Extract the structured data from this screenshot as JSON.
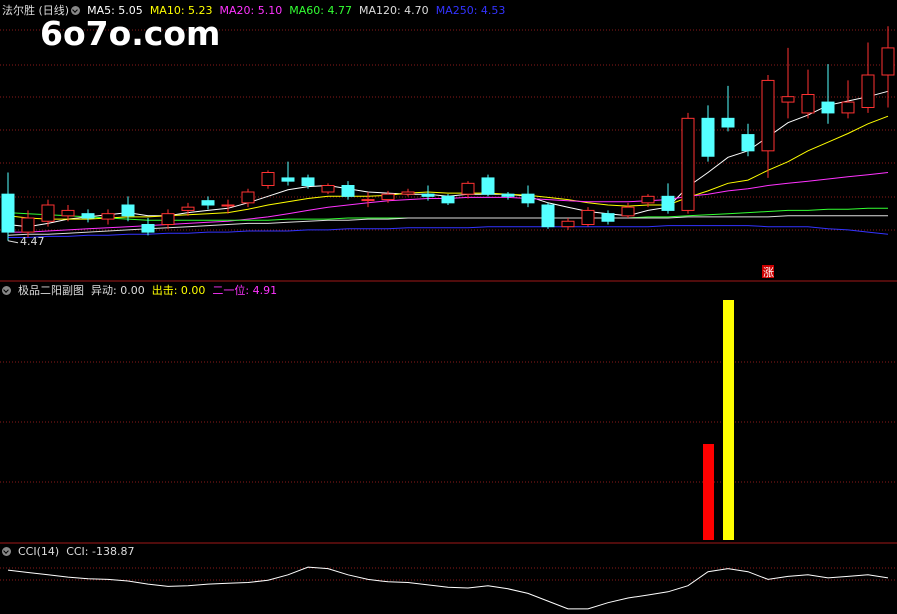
{
  "watermark": "6o7o.com",
  "main_panel": {
    "title": "法尔胜 (日线)",
    "legend": [
      {
        "label": "MA5: 5.05",
        "color": "#ffffff"
      },
      {
        "label": "MA10: 5.23",
        "color": "#ffff00"
      },
      {
        "label": "MA20: 5.10",
        "color": "#ff33ff"
      },
      {
        "label": "MA60: 4.77",
        "color": "#33ff33"
      },
      {
        "label": "MA120: 4.70",
        "color": "#dddddd"
      },
      {
        "label": "MA250: 4.53",
        "color": "#3333ff"
      }
    ],
    "low_mark": "4.47",
    "zhang_mark": "涨"
  },
  "sub_panel": {
    "title": "极品二阳副图",
    "legend": [
      {
        "label": "异动: 0.00",
        "color": "#dddddd"
      },
      {
        "label": "出击: 0.00",
        "color": "#ffff00"
      },
      {
        "label": "二一位: 4.91",
        "color": "#ff33ff"
      }
    ]
  },
  "cci_panel": {
    "title": "CCI(14)",
    "legend": [
      {
        "label": "CCI: -138.87",
        "color": "#dddddd"
      }
    ]
  },
  "chart_data": [
    {
      "type": "candlestick",
      "candles": [
        [
          4.9,
          4.55,
          5.1,
          4.47
        ],
        [
          4.55,
          4.68,
          4.75,
          4.5
        ],
        [
          4.65,
          4.8,
          4.85,
          4.6
        ],
        [
          4.7,
          4.75,
          4.8,
          4.65
        ],
        [
          4.72,
          4.68,
          4.76,
          4.64
        ],
        [
          4.67,
          4.72,
          4.76,
          4.62
        ],
        [
          4.8,
          4.7,
          4.88,
          4.65
        ],
        [
          4.62,
          4.55,
          4.68,
          4.52
        ],
        [
          4.62,
          4.72,
          4.76,
          4.58
        ],
        [
          4.75,
          4.78,
          4.82,
          4.7
        ],
        [
          4.84,
          4.8,
          4.88,
          4.76
        ],
        [
          4.8,
          4.8,
          4.85,
          4.72
        ],
        [
          4.82,
          4.92,
          4.95,
          4.78
        ],
        [
          4.98,
          5.1,
          5.12,
          4.95
        ],
        [
          5.05,
          5.02,
          5.2,
          4.98
        ],
        [
          5.05,
          4.98,
          5.08,
          4.95
        ],
        [
          4.92,
          4.98,
          5.0,
          4.9
        ],
        [
          4.98,
          4.88,
          5.02,
          4.85
        ],
        [
          4.85,
          4.85,
          4.92,
          4.78
        ],
        [
          4.85,
          4.9,
          4.93,
          4.82
        ],
        [
          4.9,
          4.92,
          4.95,
          4.88
        ],
        [
          4.9,
          4.88,
          4.98,
          4.84
        ],
        [
          4.88,
          4.82,
          4.9,
          4.8
        ],
        [
          4.9,
          5.0,
          5.02,
          4.86
        ],
        [
          5.05,
          4.9,
          5.08,
          4.88
        ],
        [
          4.9,
          4.88,
          4.92,
          4.85
        ],
        [
          4.9,
          4.82,
          4.98,
          4.78
        ],
        [
          4.8,
          4.6,
          4.82,
          4.58
        ],
        [
          4.6,
          4.65,
          4.68,
          4.57
        ],
        [
          4.62,
          4.75,
          4.78,
          4.6
        ],
        [
          4.72,
          4.65,
          4.75,
          4.62
        ],
        [
          4.7,
          4.78,
          4.82,
          4.68
        ],
        [
          4.82,
          4.88,
          4.9,
          4.78
        ],
        [
          4.88,
          4.75,
          5.0,
          4.72
        ],
        [
          4.75,
          5.6,
          5.65,
          4.72
        ],
        [
          5.6,
          5.25,
          5.72,
          5.2
        ],
        [
          5.6,
          5.52,
          5.9,
          5.48
        ],
        [
          5.45,
          5.3,
          5.55,
          5.25
        ],
        [
          5.3,
          5.95,
          6.0,
          5.05
        ],
        [
          5.75,
          5.8,
          6.25,
          5.6
        ],
        [
          5.65,
          5.82,
          6.05,
          5.6
        ],
        [
          5.75,
          5.65,
          6.1,
          5.55
        ],
        [
          5.65,
          5.75,
          5.95,
          5.6
        ],
        [
          5.7,
          6.0,
          6.3,
          5.65
        ],
        [
          6.0,
          6.25,
          6.45,
          5.7
        ]
      ],
      "ma": {
        "MA5": [
          4.62,
          4.6,
          4.63,
          4.67,
          4.69,
          4.71,
          4.73,
          4.7,
          4.7,
          4.73,
          4.75,
          4.77,
          4.82,
          4.88,
          4.94,
          4.97,
          4.98,
          4.95,
          4.92,
          4.91,
          4.9,
          4.9,
          4.88,
          4.9,
          4.9,
          4.9,
          4.88,
          4.82,
          4.78,
          4.74,
          4.72,
          4.7,
          4.75,
          4.78,
          4.97,
          5.1,
          5.24,
          5.3,
          5.43,
          5.56,
          5.63,
          5.72,
          5.76,
          5.8,
          5.85
        ],
        "MA10": [
          4.7,
          4.68,
          4.67,
          4.67,
          4.67,
          4.68,
          4.69,
          4.69,
          4.7,
          4.71,
          4.72,
          4.73,
          4.76,
          4.8,
          4.83,
          4.86,
          4.88,
          4.88,
          4.88,
          4.89,
          4.91,
          4.92,
          4.91,
          4.91,
          4.91,
          4.9,
          4.89,
          4.87,
          4.85,
          4.82,
          4.8,
          4.79,
          4.8,
          4.8,
          4.87,
          4.93,
          5.0,
          5.03,
          5.12,
          5.2,
          5.3,
          5.38,
          5.46,
          5.55,
          5.62
        ],
        "MA20": [
          4.55,
          4.55,
          4.56,
          4.57,
          4.58,
          4.59,
          4.6,
          4.61,
          4.62,
          4.63,
          4.64,
          4.65,
          4.67,
          4.69,
          4.72,
          4.75,
          4.78,
          4.8,
          4.82,
          4.84,
          4.85,
          4.86,
          4.86,
          4.87,
          4.87,
          4.87,
          4.86,
          4.85,
          4.84,
          4.83,
          4.83,
          4.83,
          4.84,
          4.85,
          4.88,
          4.9,
          4.93,
          4.95,
          4.98,
          5.0,
          5.02,
          5.04,
          5.06,
          5.08,
          5.1
        ],
        "MA60": [
          4.73,
          4.72,
          4.71,
          4.7,
          4.69,
          4.68,
          4.67,
          4.66,
          4.66,
          4.66,
          4.66,
          4.66,
          4.66,
          4.66,
          4.67,
          4.67,
          4.67,
          4.68,
          4.68,
          4.68,
          4.68,
          4.68,
          4.68,
          4.68,
          4.68,
          4.68,
          4.68,
          4.68,
          4.68,
          4.68,
          4.68,
          4.68,
          4.69,
          4.69,
          4.7,
          4.71,
          4.72,
          4.73,
          4.74,
          4.75,
          4.75,
          4.76,
          4.76,
          4.77,
          4.77
        ],
        "MA120": [
          4.52,
          4.53,
          4.53,
          4.54,
          4.55,
          4.56,
          4.57,
          4.58,
          4.59,
          4.6,
          4.61,
          4.62,
          4.63,
          4.63,
          4.64,
          4.65,
          4.66,
          4.66,
          4.67,
          4.67,
          4.68,
          4.68,
          4.68,
          4.68,
          4.68,
          4.68,
          4.68,
          4.68,
          4.68,
          4.68,
          4.68,
          4.68,
          4.68,
          4.68,
          4.69,
          4.69,
          4.69,
          4.69,
          4.69,
          4.7,
          4.7,
          4.7,
          4.7,
          4.7,
          4.7
        ],
        "MA250": [
          4.5,
          4.5,
          4.51,
          4.51,
          4.52,
          4.52,
          4.53,
          4.53,
          4.54,
          4.54,
          4.55,
          4.55,
          4.56,
          4.56,
          4.56,
          4.57,
          4.57,
          4.58,
          4.58,
          4.58,
          4.59,
          4.59,
          4.59,
          4.59,
          4.6,
          4.6,
          4.6,
          4.6,
          4.6,
          4.6,
          4.6,
          4.6,
          4.6,
          4.61,
          4.61,
          4.61,
          4.61,
          4.61,
          4.6,
          4.6,
          4.6,
          4.58,
          4.57,
          4.55,
          4.53
        ]
      },
      "ylim": [
        4.2,
        6.6
      ]
    },
    {
      "type": "bar",
      "bars": [
        {
          "index": 35,
          "value": 0.4,
          "color": "#ff0000"
        },
        {
          "index": 36,
          "value": 1.0,
          "color": "#ffff00"
        }
      ],
      "ylim": [
        0,
        1.0
      ]
    },
    {
      "type": "line",
      "name": "CCI",
      "values": [
        20,
        5,
        -10,
        -25,
        -35,
        -40,
        -50,
        -70,
        -85,
        -80,
        -70,
        -65,
        -60,
        -45,
        -10,
        40,
        30,
        -10,
        -40,
        -55,
        -60,
        -75,
        -90,
        -95,
        -80,
        -100,
        -130,
        -180,
        -230,
        -230,
        -190,
        -160,
        -140,
        -120,
        -80,
        10,
        30,
        10,
        -40,
        -20,
        -10,
        -30,
        -20,
        -10,
        -30
      ],
      "ylim": [
        -250,
        150
      ]
    }
  ]
}
